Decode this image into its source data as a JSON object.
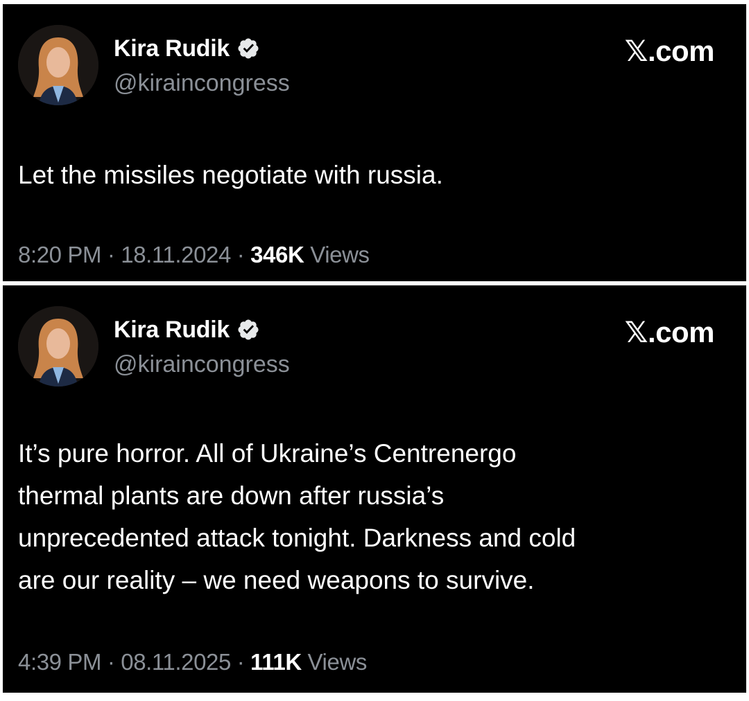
{
  "tweets": [
    {
      "author": {
        "name": "Kira Rudik",
        "handle": "@kiraincongress",
        "verified_icon": "verified-badge-icon"
      },
      "brand": "𝕏.com",
      "text": "Let the missiles negotiate with russia.",
      "time": "8:20 PM",
      "date": "18.11.2024",
      "views_count": "346K",
      "views_label": "Views"
    },
    {
      "author": {
        "name": "Kira Rudik",
        "handle": "@kiraincongress",
        "verified_icon": "verified-badge-icon"
      },
      "brand": "𝕏.com",
      "text": "It’s pure horror. All of Ukraine’s Centrenergo\nthermal plants are down after russia’s\nunprecedented attack tonight. Darkness and cold\nare our reality – we need weapons to survive.",
      "time": "4:39 PM",
      "date": "08.11.2025",
      "views_count": "111K",
      "views_label": "Views"
    }
  ],
  "colors": {
    "background": "#000000",
    "text_primary": "#ffffff",
    "text_secondary": "#8b9097",
    "verified_badge": "#e7e9ea"
  }
}
